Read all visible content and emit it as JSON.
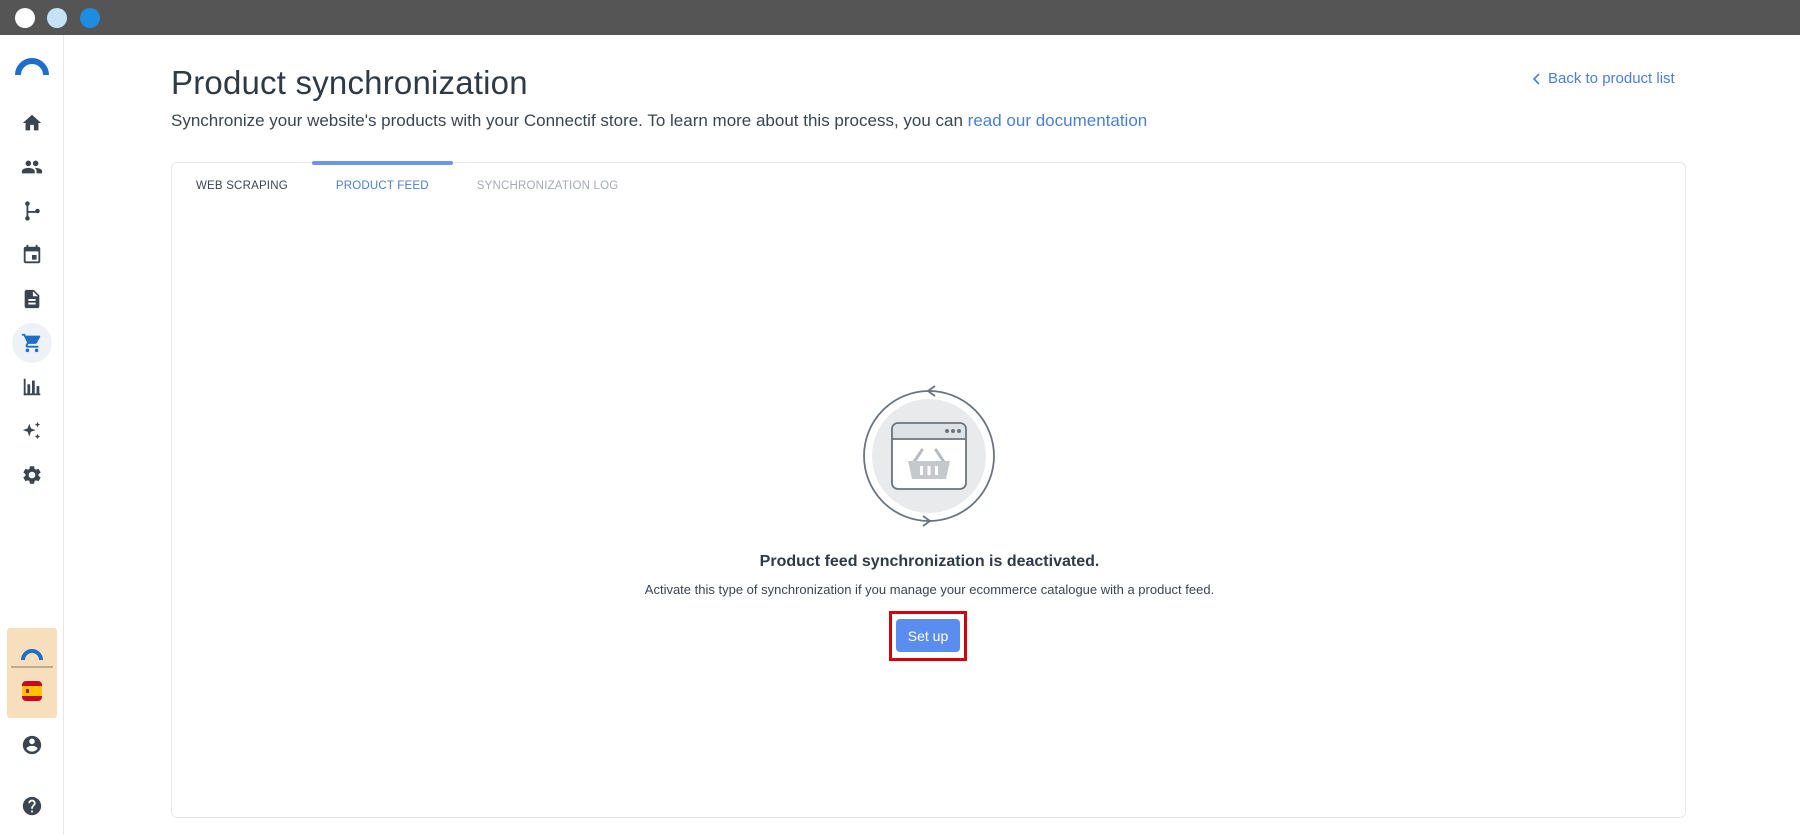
{
  "page": {
    "title": "Product synchronization",
    "subtitle_text": "Synchronize your website's products with your Connectif store. To learn more about this process, you can ",
    "subtitle_link": "read our documentation",
    "back_link": "Back to product list"
  },
  "tabs": [
    {
      "label": "WEB SCRAPING",
      "state": "default"
    },
    {
      "label": "PRODUCT FEED",
      "state": "active"
    },
    {
      "label": "SYNCHRONIZATION LOG",
      "state": "disabled"
    }
  ],
  "empty_state": {
    "title": "Product feed synchronization is deactivated.",
    "description": "Activate this type of synchronization if you manage your ecommerce catalogue with a product feed.",
    "button_label": "Set up",
    "illustration_icon": "basket-sync-icon"
  },
  "sidebar": {
    "items": [
      {
        "icon": "home-icon"
      },
      {
        "icon": "contacts-icon"
      },
      {
        "icon": "workflow-icon"
      },
      {
        "icon": "calendar-icon"
      },
      {
        "icon": "document-icon"
      },
      {
        "icon": "cart-icon",
        "active": true
      },
      {
        "icon": "bar-chart-icon"
      },
      {
        "icon": "sparkles-icon"
      },
      {
        "icon": "gear-icon"
      }
    ],
    "bottom": [
      {
        "icon": "user-icon"
      },
      {
        "icon": "help-icon"
      }
    ]
  },
  "colors": {
    "accent": "#5b8def",
    "link": "#4a7fd4",
    "highlight": "#d4000f",
    "titlebar": "#555555"
  }
}
